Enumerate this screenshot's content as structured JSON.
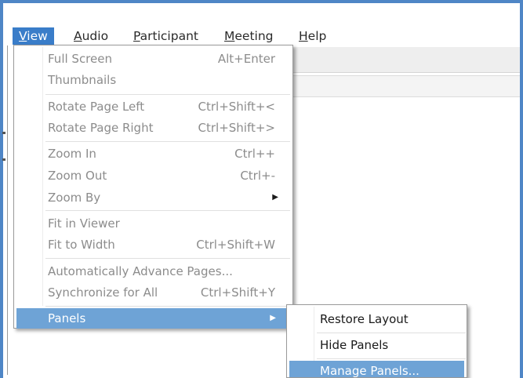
{
  "menubar": {
    "items": [
      {
        "label": "View",
        "underline": "V",
        "rest": "iew"
      },
      {
        "label": "Audio",
        "underline": "A",
        "rest": "udio"
      },
      {
        "label": "Participant",
        "underline": "P",
        "rest": "articipant"
      },
      {
        "label": "Meeting",
        "underline": "M",
        "rest": "eeting"
      },
      {
        "label": "Help",
        "underline": "H",
        "rest": "elp"
      }
    ]
  },
  "view_menu": {
    "items": [
      {
        "label": "Full Screen",
        "shortcut": "Alt+Enter"
      },
      {
        "label": "Thumbnails",
        "shortcut": ""
      },
      {
        "label": "Rotate Page Left",
        "shortcut": "Ctrl+Shift+<"
      },
      {
        "label": "Rotate Page Right",
        "shortcut": "Ctrl+Shift+>"
      },
      {
        "label": "Zoom In",
        "shortcut": "Ctrl++"
      },
      {
        "label": "Zoom Out",
        "shortcut": "Ctrl+-"
      },
      {
        "label": "Zoom By",
        "shortcut": "",
        "submenu_arrow": "▶"
      },
      {
        "label": "Fit in Viewer",
        "shortcut": ""
      },
      {
        "label": "Fit to Width",
        "shortcut": "Ctrl+Shift+W"
      },
      {
        "label": "Automatically Advance Pages...",
        "shortcut": ""
      },
      {
        "label": "Synchronize for All",
        "shortcut": "Ctrl+Shift+Y"
      },
      {
        "label": "Panels",
        "shortcut": "",
        "submenu_arrow": "▶",
        "selected": true
      }
    ]
  },
  "panels_submenu": {
    "items": [
      {
        "label": "Restore Layout"
      },
      {
        "label": "Hide Panels"
      },
      {
        "label": "Manage Panels...",
        "highlighted": true
      }
    ]
  },
  "colors": {
    "frame_border": "#4f86c6",
    "menubar_active": "#3a7dc9",
    "selection": "#6ea3d6",
    "disabled_text": "#8c8c8c"
  }
}
